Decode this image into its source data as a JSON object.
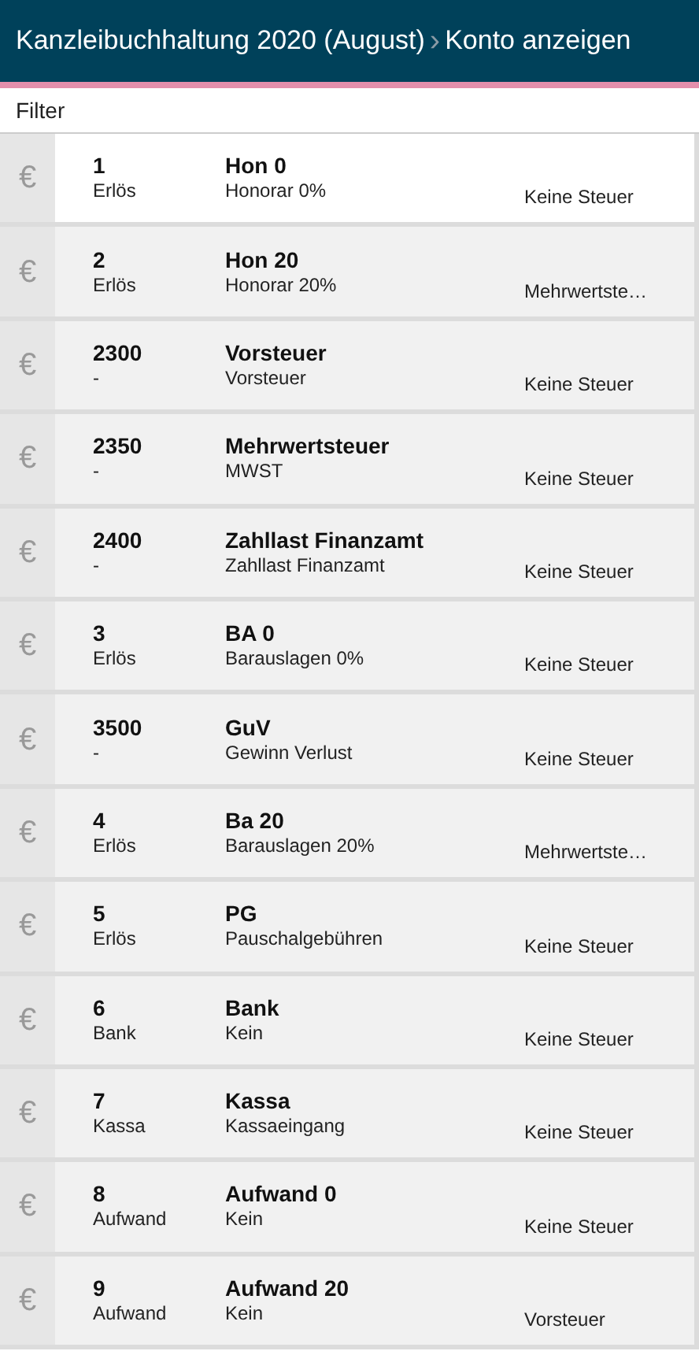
{
  "header": {
    "breadcrumbs": [
      {
        "label": "Kanzleibuchhaltung 2020 (August)"
      },
      {
        "label": "Konto anzeigen"
      }
    ],
    "separator": "›"
  },
  "filter": {
    "placeholder": "Filter"
  },
  "accounts": [
    {
      "icon": "€",
      "number": "1",
      "category": "Erlös",
      "name": "Hon 0",
      "description": "Honorar 0%",
      "tax": "Keine Steuer",
      "selected": true
    },
    {
      "icon": "€",
      "number": "2",
      "category": "Erlös",
      "name": "Hon 20",
      "description": "Honorar 20%",
      "tax": "Mehrwertste…",
      "selected": false
    },
    {
      "icon": "€",
      "number": "2300",
      "category": "-",
      "name": "Vorsteuer",
      "description": "Vorsteuer",
      "tax": "Keine Steuer",
      "selected": false
    },
    {
      "icon": "€",
      "number": "2350",
      "category": "-",
      "name": "Mehrwertsteuer",
      "description": "MWST",
      "tax": "Keine Steuer",
      "selected": false
    },
    {
      "icon": "€",
      "number": "2400",
      "category": "-",
      "name": "Zahllast Finanzamt",
      "description": "Zahllast Finanzamt",
      "tax": "Keine Steuer",
      "selected": false
    },
    {
      "icon": "€",
      "number": "3",
      "category": "Erlös",
      "name": "BA 0",
      "description": "Barauslagen 0%",
      "tax": "Keine Steuer",
      "selected": false
    },
    {
      "icon": "€",
      "number": "3500",
      "category": "-",
      "name": "GuV",
      "description": "Gewinn Verlust",
      "tax": "Keine Steuer",
      "selected": false
    },
    {
      "icon": "€",
      "number": "4",
      "category": "Erlös",
      "name": "Ba 20",
      "description": "Barauslagen 20%",
      "tax": "Mehrwertste…",
      "selected": false
    },
    {
      "icon": "€",
      "number": "5",
      "category": "Erlös",
      "name": "PG",
      "description": "Pauschalgebühren",
      "tax": "Keine Steuer",
      "selected": false
    },
    {
      "icon": "€",
      "number": "6",
      "category": "Bank",
      "name": "Bank",
      "description": "Kein",
      "tax": "Keine Steuer",
      "selected": false
    },
    {
      "icon": "€",
      "number": "7",
      "category": "Kassa",
      "name": "Kassa",
      "description": "Kassaeingang",
      "tax": "Keine Steuer",
      "selected": false
    },
    {
      "icon": "€",
      "number": "8",
      "category": "Aufwand",
      "name": "Aufwand 0",
      "description": "Kein",
      "tax": "Keine Steuer",
      "selected": false
    },
    {
      "icon": "€",
      "number": "9",
      "category": "Aufwand",
      "name": "Aufwand 20",
      "description": "Kein",
      "tax": "Vorsteuer",
      "selected": false
    }
  ]
}
